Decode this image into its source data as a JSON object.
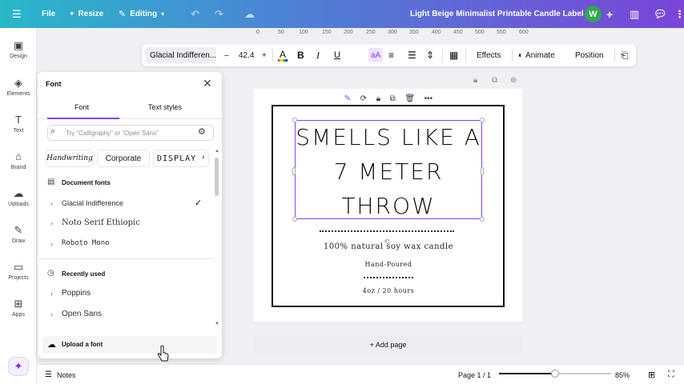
{
  "topbar": {
    "menu_icon": "hamburger-icon",
    "file": "File",
    "resize": "Resize",
    "editing": "Editing",
    "title": "Light Beige Minimalist Printable Candle Label",
    "avatar_initial": "W",
    "add": "+"
  },
  "rail": {
    "items": [
      {
        "label": "Design",
        "icon": "design-icon"
      },
      {
        "label": "Elements",
        "icon": "elements-icon"
      },
      {
        "label": "Text",
        "icon": "text-icon"
      },
      {
        "label": "Brand",
        "icon": "brand-icon"
      },
      {
        "label": "Uploads",
        "icon": "uploads-icon"
      },
      {
        "label": "Draw",
        "icon": "draw-icon"
      },
      {
        "label": "Projects",
        "icon": "projects-icon"
      },
      {
        "label": "Apps",
        "icon": "apps-icon"
      }
    ]
  },
  "ruler": {
    "ticks": [
      "0",
      "50",
      "100",
      "150",
      "200",
      "250",
      "300",
      "350",
      "400",
      "450",
      "500",
      "550",
      "600"
    ]
  },
  "toolbar": {
    "font_name": "Glacial Indifferen...",
    "minus": "–",
    "font_size": "42.4",
    "plus": "+",
    "color_letter": "A",
    "bold": "B",
    "italic": "I",
    "underline": "U",
    "case": "aA",
    "effects": "Effects",
    "animate": "Animate",
    "position": "Position"
  },
  "panel": {
    "title": "Font",
    "tabs": [
      "Font",
      "Text styles"
    ],
    "search_placeholder": "Try “Calligraphy” or “Open Sans”",
    "chips": [
      "Handwriting",
      "Corporate",
      "DISPLAY"
    ],
    "document_fonts_heading": "Document fonts",
    "document_fonts": [
      "Glacial Indifference",
      "Noto Serif Ethiopic",
      "Roboto Mono"
    ],
    "recently_used_heading": "Recently used",
    "recent_fonts": [
      "Poppins",
      "Open Sans"
    ],
    "upload": "Upload a font"
  },
  "canvas": {
    "headline": [
      "SMELLS LIKE A",
      "7 METER",
      "THROW"
    ],
    "line1": "100% natural soy wax candle",
    "line2": "Hand-Poured",
    "line3": "4oz / 20 hours",
    "add_page": "+ Add page"
  },
  "bottombar": {
    "notes": "Notes",
    "page": "Page 1 / 1",
    "zoom": "85%",
    "zoom_level": 0.5
  },
  "colors": {
    "accent": "#8b3dff",
    "avatar": "#2fa84f"
  }
}
